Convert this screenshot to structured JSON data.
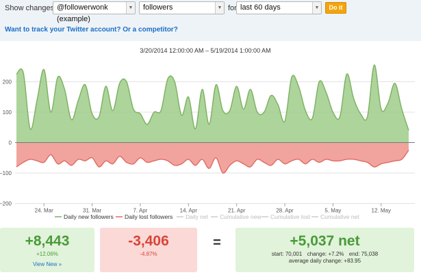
{
  "controls": {
    "show_label": "Show changes in",
    "account_value": "@followerwonk (example)",
    "metric_value": "followers",
    "for_label": "for",
    "period_value": "last 60 days",
    "doit_label": "Do it"
  },
  "track_link": "Want to track your Twitter account? Or a competitor?",
  "chart_data": {
    "type": "area",
    "title": "3/20/2014 12:00:00 AM – 5/19/2014 1:00:00 AM",
    "ylim": [
      -200,
      250
    ],
    "yticks": [
      "200",
      "100",
      "0",
      "−100",
      "−200"
    ],
    "ytick_values": [
      200,
      100,
      0,
      -100,
      -200
    ],
    "xtick_labels": [
      "24. Mar",
      "31. Mar",
      "7. Apr",
      "14. Apr",
      "21. Apr",
      "28. Apr",
      "5. May",
      "12. May"
    ],
    "xtick_days": [
      4,
      11,
      18,
      25,
      32,
      39,
      46,
      53
    ],
    "x_start": "2014-03-20",
    "series": [
      {
        "name": "Daily new followers",
        "color": "#7cb05f",
        "values": [
          225,
          230,
          45,
          140,
          240,
          100,
          215,
          175,
          75,
          140,
          190,
          95,
          85,
          185,
          105,
          195,
          200,
          110,
          95,
          60,
          100,
          105,
          210,
          200,
          90,
          150,
          45,
          175,
          60,
          190,
          105,
          105,
          185,
          110,
          175,
          100,
          100,
          155,
          125,
          70,
          215,
          185,
          105,
          80,
          200,
          165,
          100,
          85,
          225,
          145,
          95,
          85,
          255,
          110,
          130,
          195,
          110,
          40
        ]
      },
      {
        "name": "Daily lost followers",
        "color": "#e06a5f",
        "values": [
          -80,
          -65,
          -55,
          -60,
          -65,
          -40,
          -70,
          -60,
          -75,
          -55,
          -60,
          -50,
          -80,
          -60,
          -70,
          -45,
          -65,
          -70,
          -50,
          -65,
          -60,
          -55,
          -60,
          -75,
          -70,
          -55,
          -75,
          -55,
          -85,
          -50,
          -100,
          -75,
          -60,
          -70,
          -80,
          -55,
          -65,
          -75,
          -55,
          -70,
          -60,
          -55,
          -70,
          -55,
          -65,
          -55,
          -60,
          -60,
          -55,
          -55,
          -60,
          -65,
          -80,
          -70,
          -65,
          -60,
          -55,
          -25
        ]
      }
    ],
    "legend": {
      "active": [
        "Daily new followers",
        "Daily lost followers"
      ],
      "inactive": [
        "Daily net",
        "Cumulative new",
        "Cumulative lost",
        "Cumulative net"
      ],
      "placement": "bottom"
    }
  },
  "summary": {
    "new": {
      "value": "+8,443",
      "pct": "+12.06%",
      "link": "View New »"
    },
    "lost": {
      "value": "-3,406",
      "pct": "-4.87%"
    },
    "equals": "=",
    "net": {
      "value": "+5,037 net",
      "start": "start: 70,001",
      "change": "change: +7.2%",
      "end": "end: 75,038",
      "avg": "average daily change: +83.95"
    }
  }
}
